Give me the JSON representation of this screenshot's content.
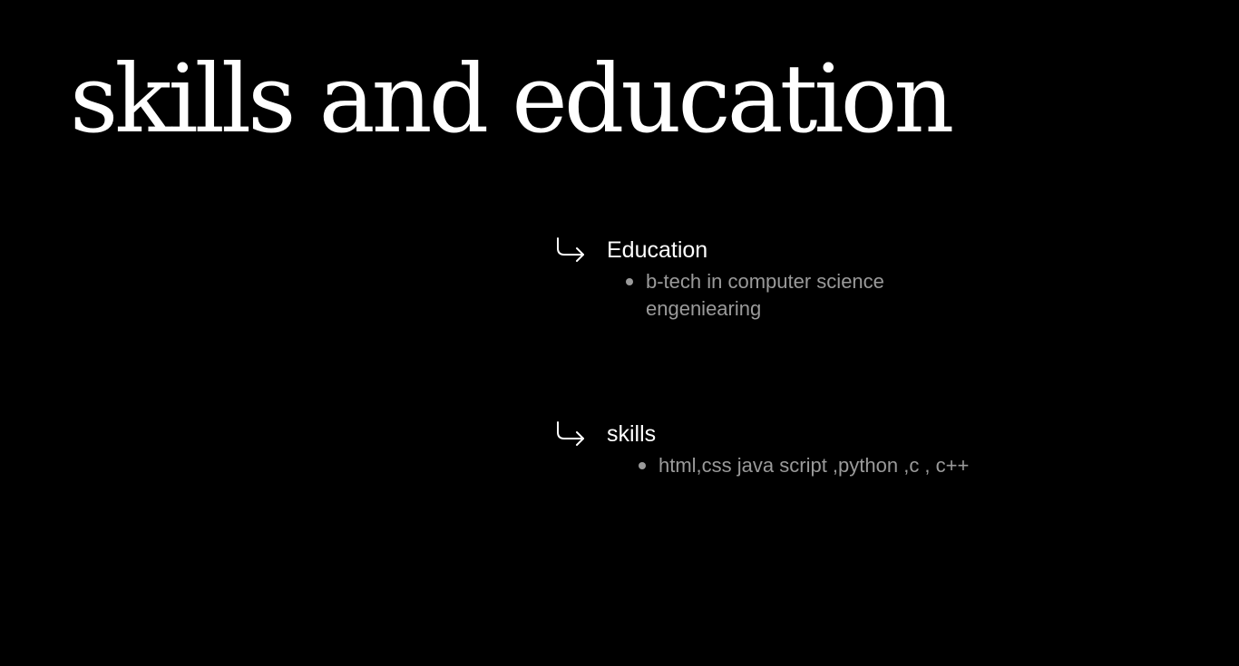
{
  "page": {
    "title": "skills and education"
  },
  "sections": [
    {
      "icon": "arrow-down-right-icon",
      "label": "Education",
      "items": [
        "b-tech in computer science engeniearing"
      ]
    },
    {
      "icon": "arrow-down-right-icon",
      "label": "skills",
      "items": [
        "html,css java script ,python ,c , c++"
      ]
    }
  ],
  "colors": {
    "background": "#000000",
    "heading": "#ffffff",
    "body_text": "#9a9a9a"
  }
}
